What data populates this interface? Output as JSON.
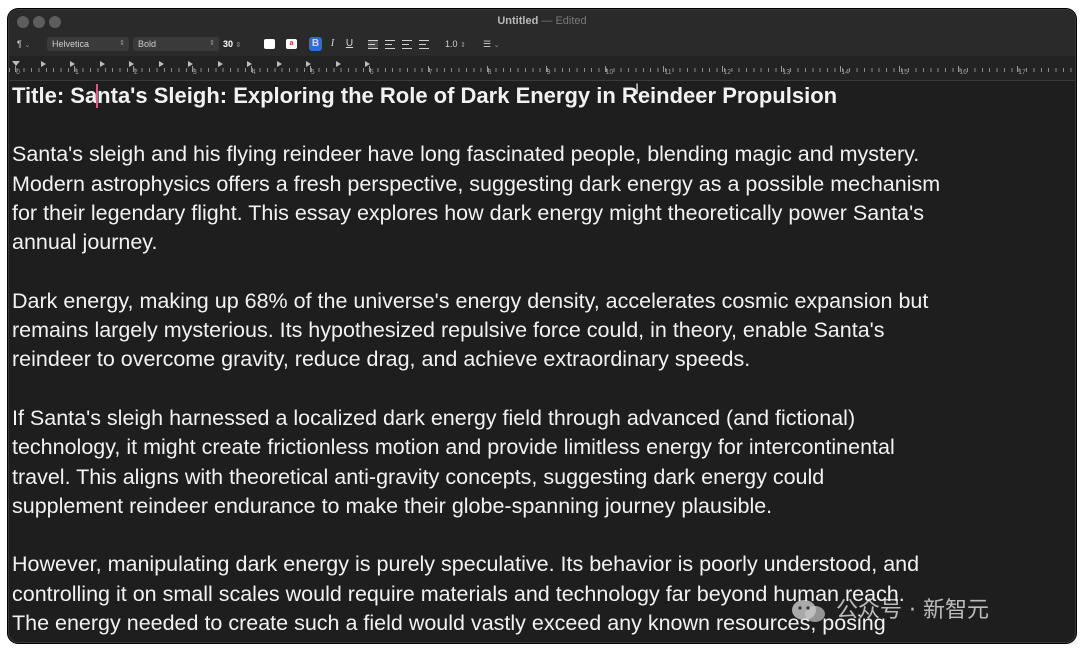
{
  "window": {
    "title": "Untitled",
    "separator": "—",
    "status": "Edited"
  },
  "toolbar": {
    "paragraph_style": "¶",
    "font_family": "Helvetica",
    "font_style": "Bold",
    "font_size": "30",
    "text_color": "#ffffff",
    "highlight_label": "a",
    "bold": "B",
    "italic": "I",
    "underline": "U",
    "line_spacing": "1.0",
    "list_icon": "list-icon"
  },
  "ruler": {
    "labels": [
      "0",
      "1",
      "2",
      "3",
      "4",
      "5",
      "6",
      "7",
      "8",
      "9",
      "10",
      "11",
      "12",
      "13",
      "14",
      "15",
      "16",
      "17"
    ]
  },
  "document": {
    "title": "Title: Santa's Sleigh: Exploring the Role of Dark Energy in Reindeer Propulsion",
    "paragraphs": [
      {
        "lines": [
          "Santa's sleigh and his flying reindeer have long fascinated people, blending magic and mystery.",
          "Modern astrophysics offers a fresh perspective, suggesting dark energy as a possible mechanism",
          "for their legendary flight. This essay explores how dark energy might theoretically power Santa's",
          "annual journey."
        ]
      },
      {
        "lines": [
          "Dark energy, making up 68% of the universe's energy density, accelerates cosmic expansion but",
          "remains largely mysterious. Its hypothesized repulsive force could, in theory, enable Santa's",
          "reindeer to overcome gravity, reduce drag, and achieve extraordinary speeds."
        ]
      },
      {
        "lines": [
          "If Santa's sleigh harnessed a localized dark energy field through advanced (and fictional)",
          "technology, it might create frictionless motion and provide limitless energy for intercontinental",
          "travel. This aligns with theoretical anti-gravity concepts, suggesting dark energy could",
          "supplement reindeer endurance to make their globe-spanning journey plausible."
        ]
      },
      {
        "lines": [
          "However, manipulating dark energy is purely speculative. Its behavior is poorly understood, and",
          "controlling it on small scales would require materials and technology far beyond human reach.",
          "The energy needed to create such a field would vastly exceed any known resources, posing"
        ]
      }
    ]
  },
  "watermark": {
    "text": "公众号 · 新智元"
  }
}
